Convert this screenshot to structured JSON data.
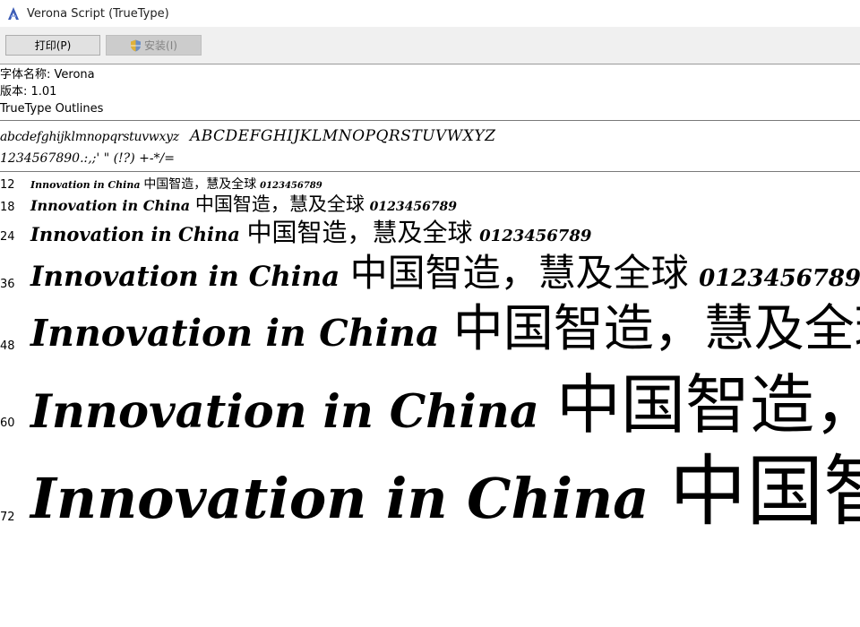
{
  "window": {
    "title": "Verona Script (TrueType)"
  },
  "toolbar": {
    "print_label": "打印(P)",
    "install_label": "安装(I)"
  },
  "info": {
    "font_name_line": "字体名称: Verona",
    "version_line": "版本: 1.01",
    "outlines_line": "TrueType Outlines"
  },
  "charset": {
    "lowercase": "abcdefghijklmnopqrstuvwxyz",
    "uppercase": "ABCDEFGHIJKLMNOPQRSTUVWXYZ",
    "digits_symbols": "1234567890.:,;' \" (!?) +-*/="
  },
  "samples": {
    "latin": "Innovation in China",
    "cjk": "中国智造，慧及全球",
    "digits": "0123456789",
    "sizes": [
      {
        "size_label": "12",
        "font_px": 12
      },
      {
        "size_label": "18",
        "font_px": 18
      },
      {
        "size_label": "24",
        "font_px": 24
      },
      {
        "size_label": "36",
        "font_px": 36
      },
      {
        "size_label": "48",
        "font_px": 48
      },
      {
        "size_label": "60",
        "font_px": 60
      },
      {
        "size_label": "72",
        "font_px": 72
      }
    ]
  },
  "icons": {
    "app_icon": "font-file-icon",
    "install_icon": "shield-icon"
  }
}
